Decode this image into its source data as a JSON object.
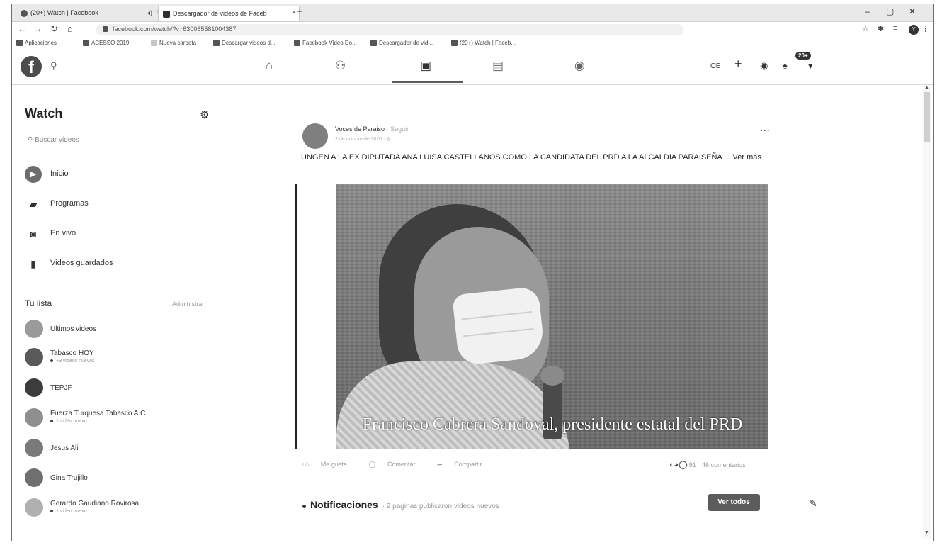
{
  "browser": {
    "tabs": [
      {
        "title": "(20+) Watch | Facebook",
        "active": false
      },
      {
        "title": "Descargador de videos de Faceb",
        "active": true
      }
    ],
    "new_tab": "+",
    "url": "facebook.com/watch/?v=630065581004387",
    "bookmarks": [
      "Aplicaciones",
      "ACESSO 2019",
      "Nueva carpeta",
      "Descargar videos d...",
      "Facebook Video Do...",
      "Descargador de vid...",
      "(20+) Watch | Faceb..."
    ],
    "profile_initial": "Y"
  },
  "header": {
    "notifications_badge": "20+",
    "create_label": "+",
    "user_short": "OE"
  },
  "sidebar": {
    "title": "Watch",
    "search_placeholder": "Buscar videos",
    "nav": [
      {
        "label": "Inicio",
        "icon": "play-icon"
      },
      {
        "label": "Programas",
        "icon": "shows-icon"
      },
      {
        "label": "En vivo",
        "icon": "live-icon"
      },
      {
        "label": "Videos guardados",
        "icon": "bookmark-icon"
      }
    ],
    "list_title": "Tu lista",
    "manage_label": "Administrar",
    "list": [
      {
        "name": "Ultimos videos",
        "sub": ""
      },
      {
        "name": "Tabasco HOY",
        "sub": "+9 videos nuevos"
      },
      {
        "name": "TEPJF",
        "sub": ""
      },
      {
        "name": "Fuerza Turquesa Tabasco A.C.",
        "sub": "1 video nuevo"
      },
      {
        "name": "Jesus Ali",
        "sub": ""
      },
      {
        "name": "Gina Trujillo",
        "sub": ""
      },
      {
        "name": "Gerardo Gaudiano Rovirosa",
        "sub": "1 video nuevo"
      }
    ]
  },
  "post": {
    "author": "Voces de Paraiso",
    "follow": "· Seguir",
    "date": "2 de octubre de 2020 ·",
    "more": "···",
    "text": "UNGEN A LA EX DIPUTADA ANA LUISA CASTELLANOS COMO LA CANDIDATA DEL PRD A LA ALCALDIA PARAISEÑA ... Ver mas",
    "video_caption": "Francisco Cabrera Sandoval, presidente  estatal del PRD",
    "actions": [
      "Me gusta",
      "Comentar",
      "Compartir"
    ],
    "reaction_count": "91",
    "comments_count": "46 comentarios"
  },
  "notifications": {
    "title": "Notificaciones",
    "subtitle": "· 2 paginas publicaron videos nuevos",
    "button": "Ver todos"
  }
}
